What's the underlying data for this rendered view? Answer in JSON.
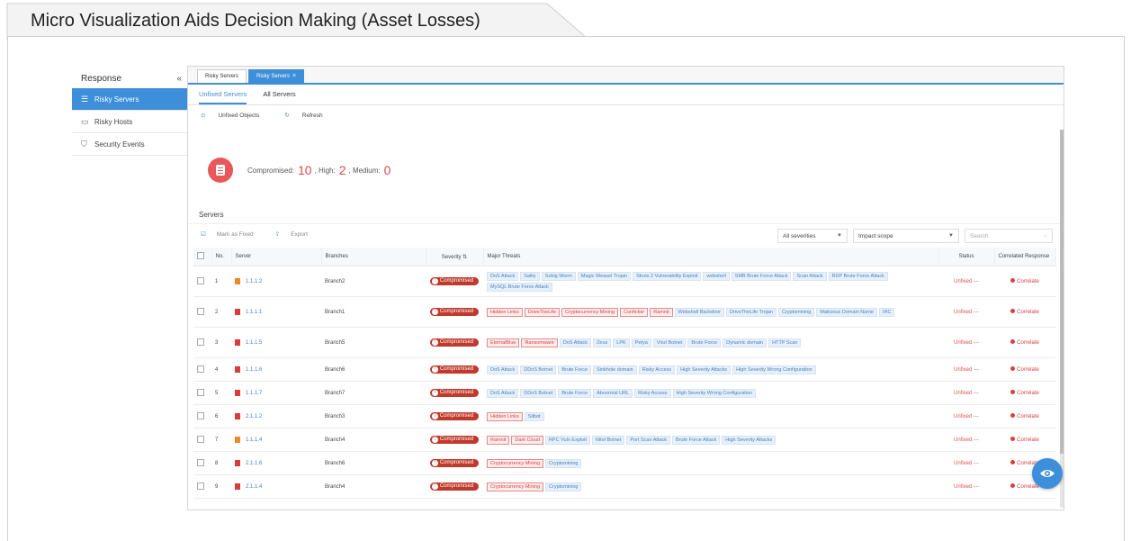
{
  "page": {
    "title": "Micro Visualization Aids Decision Making (Asset Losses)"
  },
  "nav": {
    "header": "Response",
    "collapse_glyph": "«",
    "items": [
      {
        "label": "Risky Servers",
        "icon": "server-list-icon",
        "active": true
      },
      {
        "label": "Risky Hosts",
        "icon": "monitor-icon",
        "active": false
      },
      {
        "label": "Security Events",
        "icon": "shield-icon",
        "active": false
      }
    ]
  },
  "tabs": [
    {
      "label": "Risky Servers",
      "active": false
    },
    {
      "label": "Risky Servers",
      "active": true,
      "close": "×"
    }
  ],
  "subtabs": [
    {
      "label": "Unfixed Servers",
      "active": true
    },
    {
      "label": "All Servers",
      "active": false
    }
  ],
  "toolbar": {
    "unfixed_objects": "Unfixed Objects",
    "refresh": "Refresh"
  },
  "summary": {
    "compromised_label": "Compromised:",
    "compromised": "10",
    "high_label": ", High:",
    "high": "2",
    "medium_label": ", Medium:",
    "medium": "0"
  },
  "servers_label": "Servers",
  "table_toolbar": {
    "mark_fixed": "Mark as Fixed",
    "export": "Export"
  },
  "filters": {
    "severity": "All severities",
    "scope": "Impact scope",
    "search_placeholder": "Search"
  },
  "columns": {
    "no": "No.",
    "server": "Server",
    "branches": "Branches",
    "severity": "Severity",
    "threats": "Major Threats",
    "status": "Status",
    "correlated": "Correlated Response"
  },
  "rows": [
    {
      "no": "1",
      "server": "1.1.1.2",
      "icon_color": "orange",
      "branch": "Branch2",
      "severity": "Compromised",
      "threats": [
        {
          "t": "DoS Attack"
        },
        {
          "t": "Sality"
        },
        {
          "t": "Sobig Worm"
        },
        {
          "t": "Magic Weasel Trojan"
        },
        {
          "t": "Struts 2 Vulnerability Exploit"
        },
        {
          "t": "webshell"
        },
        {
          "t": "SMB Brute Force Attack"
        },
        {
          "t": "Scan Attack"
        },
        {
          "t": "RDP Brute Force Attack"
        },
        {
          "t": "MySQL Brute Force Attack"
        }
      ],
      "status": "Unfixed ---",
      "correlated": "Correlate"
    },
    {
      "no": "2",
      "server": "1.1.1.1",
      "icon_color": "red",
      "branch": "Branch1",
      "severity": "Compromised",
      "threats": [
        {
          "t": "Hidden Links",
          "red": true
        },
        {
          "t": "DriveTheLife",
          "red": true
        },
        {
          "t": "Cryptocurrency Mining",
          "red": true
        },
        {
          "t": "Conficker",
          "red": true
        },
        {
          "t": "Ramnit",
          "red": true
        },
        {
          "t": "Webshell Backdoor"
        },
        {
          "t": "DriveTheLife Trojan"
        },
        {
          "t": "Cryptomining"
        },
        {
          "t": "Malicious Domain Name"
        },
        {
          "t": "IRC"
        }
      ],
      "status": "Unfixed ---",
      "correlated": "Correlate"
    },
    {
      "no": "3",
      "server": "1.1.1.5",
      "icon_color": "red",
      "branch": "Branch5",
      "severity": "Compromised",
      "threats": [
        {
          "t": "EternalBlue",
          "red": true
        },
        {
          "t": "Ransomware",
          "red": true
        },
        {
          "t": "DoS Attack"
        },
        {
          "t": "Zeus"
        },
        {
          "t": "LPK"
        },
        {
          "t": "Petya"
        },
        {
          "t": "Virut Botnet"
        },
        {
          "t": "Brute Force"
        },
        {
          "t": "Dynamic domain"
        },
        {
          "t": "HTTP Scan"
        }
      ],
      "status": "Unfixed ---",
      "correlated": "Correlate"
    },
    {
      "no": "4",
      "server": "1.1.1.6",
      "icon_color": "red",
      "branch": "Branch6",
      "severity": "Compromised",
      "threats": [
        {
          "t": "DoS Attack"
        },
        {
          "t": "DDoS Botnet"
        },
        {
          "t": "Brute Force"
        },
        {
          "t": "Sinkhole domain"
        },
        {
          "t": "Risky Access"
        },
        {
          "t": "High Severity Attacks"
        },
        {
          "t": "High Severity Wrong Configuration"
        }
      ],
      "status": "Unfixed ---",
      "correlated": "Correlate"
    },
    {
      "no": "5",
      "server": "1.1.1.7",
      "icon_color": "red",
      "branch": "Branch7",
      "severity": "Compromised",
      "threats": [
        {
          "t": "DoS Attack"
        },
        {
          "t": "DDoS Botnet"
        },
        {
          "t": "Brute Force"
        },
        {
          "t": "Abnormal URL"
        },
        {
          "t": "Risky Access"
        },
        {
          "t": "High Severity Wrong Configuration"
        }
      ],
      "status": "Unfixed ---",
      "correlated": "Correlate"
    },
    {
      "no": "6",
      "server": "2.1.1.2",
      "icon_color": "red",
      "branch": "Branch3",
      "severity": "Compromised",
      "threats": [
        {
          "t": "Hidden Links",
          "red": true
        },
        {
          "t": "Silbot"
        }
      ],
      "status": "Unfixed ---",
      "correlated": "Correlate"
    },
    {
      "no": "7",
      "server": "1.1.1.4",
      "icon_color": "orange",
      "branch": "Branch4",
      "severity": "Compromised",
      "threats": [
        {
          "t": "Ramnit",
          "red": true
        },
        {
          "t": "Dark Cloud",
          "red": true
        },
        {
          "t": "RPC Vuln Exploit"
        },
        {
          "t": "Nitol Botnet"
        },
        {
          "t": "Port Scan Attack"
        },
        {
          "t": "Brute Force Attack"
        },
        {
          "t": "High Severity Attacks"
        }
      ],
      "status": "Unfixed ---",
      "correlated": "Correlate"
    },
    {
      "no": "8",
      "server": "2.1.1.6",
      "icon_color": "red",
      "branch": "Branch6",
      "severity": "Compromised",
      "threats": [
        {
          "t": "Cryptocurrency Mining",
          "red": true
        },
        {
          "t": "Cryptomining"
        }
      ],
      "status": "Unfixed ---",
      "correlated": "Correlate"
    },
    {
      "no": "9",
      "server": "2.1.1.4",
      "icon_color": "red",
      "branch": "Branch4",
      "severity": "Compromised",
      "threats": [
        {
          "t": "Cryptocurrency Mining",
          "red": true
        },
        {
          "t": "Cryptomining"
        }
      ],
      "status": "Unfixed ---",
      "correlated": "Correlate"
    }
  ],
  "colors": {
    "accent": "#3e8fd9",
    "danger": "#c0392b",
    "summary_icon": "#e8585a"
  }
}
